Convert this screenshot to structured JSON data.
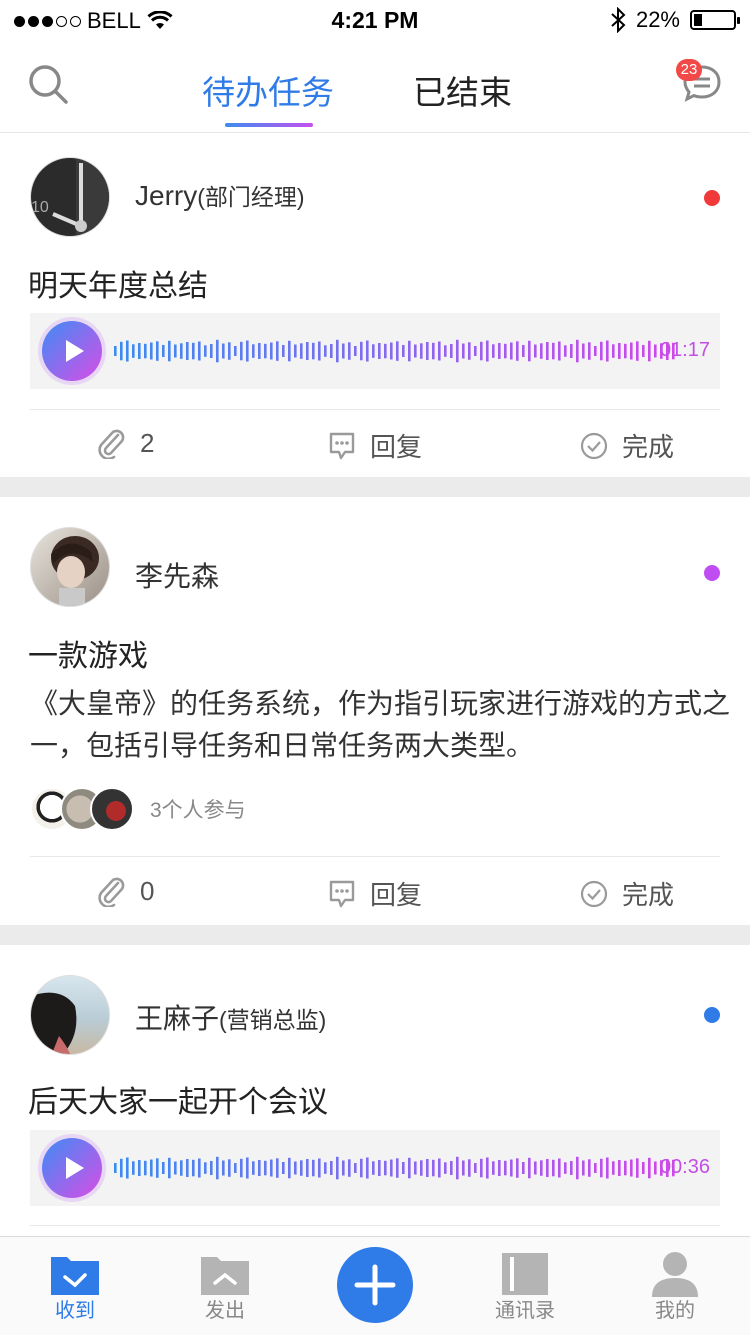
{
  "status_bar": {
    "carrier": "BELL",
    "time": "4:21 PM",
    "battery": "22%",
    "battery_level": 0.22
  },
  "header": {
    "tabs": [
      "待办任务",
      "已结束"
    ],
    "active_tab": 0,
    "unread_badge": "23"
  },
  "tasks": [
    {
      "user": "Jerry",
      "role": "(部门经理)",
      "title": "明天年度总结",
      "voice_duration": "01:17",
      "priority_color": "#f03a3a",
      "attachments": "2",
      "reply": "回复",
      "done": "完成"
    },
    {
      "user": "李先森",
      "role": "",
      "title": "一款游戏",
      "description": "《大皇帝》的任务系统，作为指引玩家进行游戏的方式之一，包括引导任务和日常任务两大类型。",
      "participants_label": "3个人参与",
      "priority_color": "#c04df2",
      "attachments": "0",
      "reply": "回复",
      "done": "完成"
    },
    {
      "user": "王麻子",
      "role": "(营销总监)",
      "title": "后天大家一起开个会议",
      "voice_duration": "00:36",
      "priority_color": "#2f7be8"
    }
  ],
  "tabbar": {
    "items": [
      "收到",
      "发出",
      "通讯录",
      "我的"
    ],
    "active": 0
  },
  "colors": {
    "accent": "#2f7be8",
    "gradient_end": "#c64ff0"
  }
}
